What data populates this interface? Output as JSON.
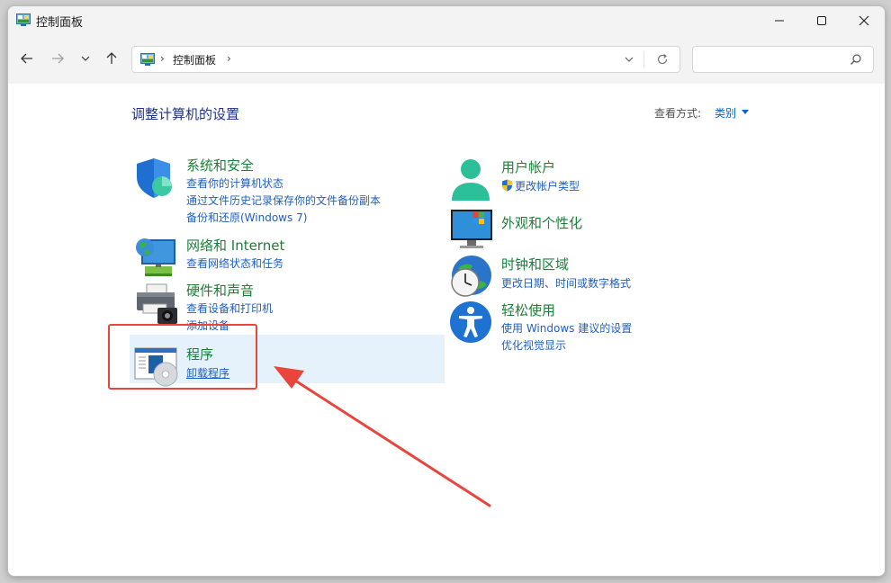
{
  "window": {
    "title": "控制面板"
  },
  "address": {
    "crumb": "控制面板",
    "separator": "›"
  },
  "search": {
    "placeholder": ""
  },
  "content": {
    "heading": "调整计算机的设置",
    "view_label": "查看方式:",
    "view_value": "类别"
  },
  "categories": [
    {
      "title": "系统和安全",
      "icon": "shield-icon",
      "links": [
        "查看你的计算机状态",
        "通过文件历史记录保存你的文件备份副本",
        "备份和还原(Windows 7)"
      ]
    },
    {
      "title": "网络和 Internet",
      "icon": "network-icon",
      "links": [
        "查看网络状态和任务"
      ]
    },
    {
      "title": "硬件和声音",
      "icon": "printer-icon",
      "links": [
        "查看设备和打印机",
        "添加设备"
      ]
    },
    {
      "title": "程序",
      "icon": "programs-icon",
      "links": [
        "卸载程序"
      ]
    },
    {
      "title": "用户帐户",
      "icon": "user-icon",
      "links": [
        "更改帐户类型"
      ]
    },
    {
      "title": "外观和个性化",
      "icon": "appearance-icon",
      "links": []
    },
    {
      "title": "时钟和区域",
      "icon": "clock-icon",
      "links": [
        "更改日期、时间或数字格式"
      ]
    },
    {
      "title": "轻松使用",
      "icon": "accessibility-icon",
      "links": [
        "使用 Windows 建议的设置",
        "优化视觉显示"
      ]
    }
  ],
  "colors": {
    "category_title": "#1a7f37",
    "link": "#1f5fbf",
    "heading": "#1e3287",
    "highlight": "#e5f1fb",
    "annotation": "#e8453c"
  }
}
